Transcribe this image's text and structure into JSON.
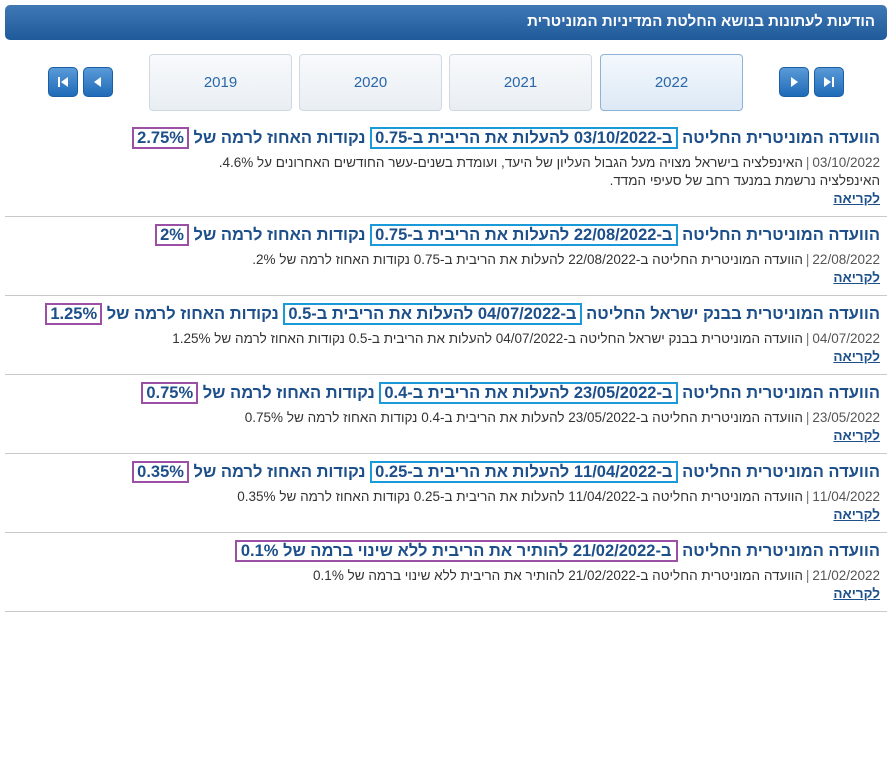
{
  "header": {
    "title": "הודעות לעתונות בנושא החלטת המדיניות המוניטרית"
  },
  "years": [
    {
      "label": "2022",
      "active": true
    },
    {
      "label": "2021",
      "active": false
    },
    {
      "label": "2020",
      "active": false
    },
    {
      "label": "2019",
      "active": false
    }
  ],
  "nav_icons": {
    "first": "skip-to-first-icon",
    "prev": "chevron-left-icon",
    "next": "chevron-right-icon",
    "last": "skip-to-last-icon"
  },
  "colors": {
    "header": "#1f5a9a",
    "link": "#1d4f8a",
    "date_highlight": "#1a9ad8",
    "rate_highlight": "#9b4fa5"
  },
  "read_more_label": "לקריאה",
  "items": [
    {
      "title_pre": "הוועדה המוניטרית החליטה ",
      "title_hl": "ב-03/10/2022 להעלות את הריבית ב-0.75",
      "title_mid": " נקודות האחוז לרמה של ",
      "title_rate": "2.75%",
      "date": "03/10/2022",
      "summary": "האינפלציה בישראל מצויה מעל הגבול העליון של היעד, ועומדת בשנים-עשר החודשים האחרונים על 4.6%.",
      "summary2": "האינפלציה נרשמת במנעד רחב של סעיפי המדד."
    },
    {
      "title_pre": "הוועדה המוניטרית החליטה ",
      "title_hl": "ב-22/08/2022 להעלות את הריבית ב-0.75",
      "title_mid": " נקודות האחוז לרמה של ",
      "title_rate": "2%",
      "date": "22/08/2022",
      "summary": "הוועדה המוניטרית החליטה ב-22/08/2022 להעלות את הריבית ב-0.75 נקודות האחוז לרמה של 2%.",
      "summary2": ""
    },
    {
      "title_pre": "הוועדה המוניטרית בבנק ישראל החליטה ",
      "title_hl": "ב-04/07/2022 להעלות את הריבית ב-0.5",
      "title_mid": " נקודות האחוז לרמה של ",
      "title_rate": "1.25%",
      "date": "04/07/2022",
      "summary": "הוועדה המוניטרית בבנק ישראל החליטה ב-04/07/2022 להעלות את הריבית ב-0.5 נקודות האחוז לרמה של 1.25%",
      "summary2": ""
    },
    {
      "title_pre": "הוועדה המוניטרית החליטה ",
      "title_hl": "ב-23/05/2022 להעלות את הריבית ב-0.4",
      "title_mid": " נקודות האחוז לרמה של ",
      "title_rate": "0.75%",
      "date": "23/05/2022",
      "summary": "הוועדה המוניטרית החליטה ב-23/05/2022 להעלות את הריבית ב-0.4 נקודות האחוז לרמה של 0.75%",
      "summary2": ""
    },
    {
      "title_pre": "הוועדה המוניטרית החליטה ",
      "title_hl": "ב-11/04/2022 להעלות את הריבית ב-0.25",
      "title_mid": " נקודות האחוז לרמה של ",
      "title_rate": "0.35%",
      "date": "11/04/2022",
      "summary": "הוועדה המוניטרית החליטה ב-11/04/2022 להעלות את הריבית ב-0.25 נקודות האחוז לרמה של 0.35%",
      "summary2": ""
    },
    {
      "title_pre": "הוועדה המוניטרית החליטה ",
      "title_whole_hl": "ב-21/02/2022 להותיר את הריבית ללא שינוי ברמה של 0.1%",
      "date": "21/02/2022",
      "summary": "הוועדה המוניטרית החליטה ב-21/02/2022 להותיר את הריבית ללא שינוי ברמה של 0.1%",
      "summary2": ""
    }
  ]
}
